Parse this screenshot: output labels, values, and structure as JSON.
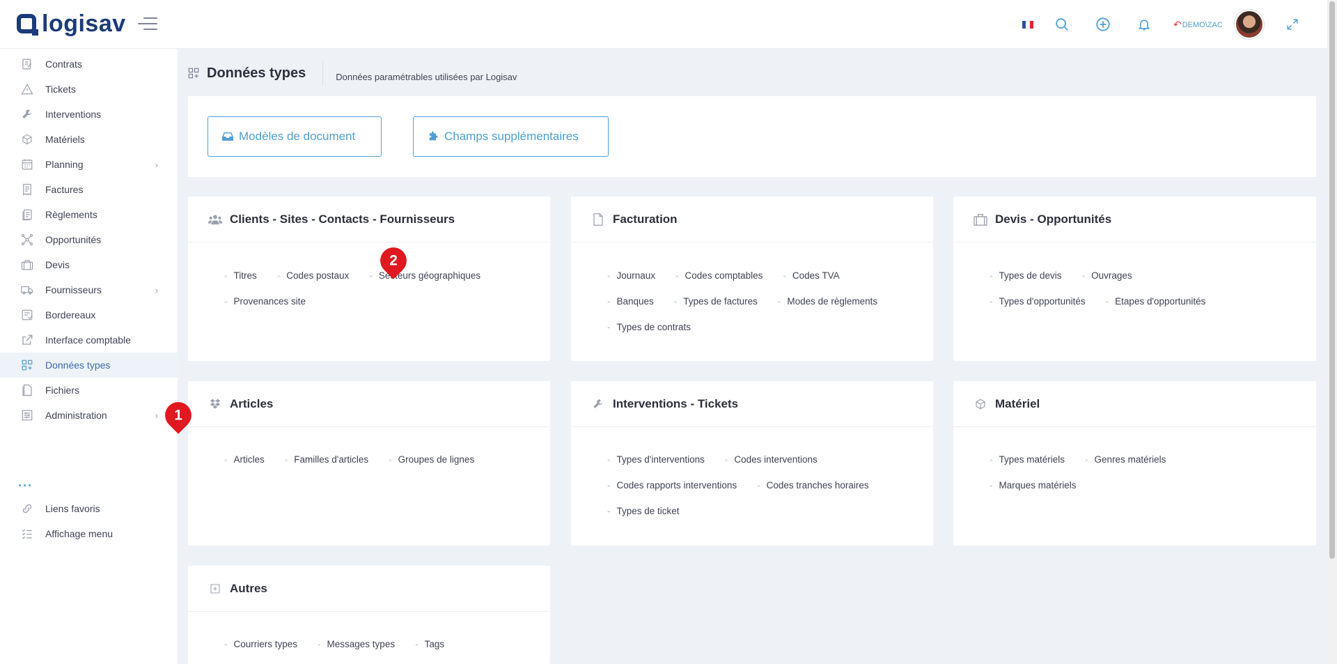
{
  "header": {
    "logo_text": "logisav",
    "flag_colors": [
      "#2b4fa6",
      "#ffffff",
      "#e4262c"
    ],
    "user_label": "DEMO\\ZAC",
    "icons": [
      "search-icon",
      "plus-circle-icon",
      "bell-icon",
      "expand-icon"
    ]
  },
  "sidebar": {
    "items": [
      {
        "label": "Contrats",
        "icon": "contract-icon"
      },
      {
        "label": "Tickets",
        "icon": "warning-icon"
      },
      {
        "label": "Interventions",
        "icon": "wrench-icon"
      },
      {
        "label": "Matériels",
        "icon": "box-icon"
      },
      {
        "label": "Planning",
        "icon": "calendar-icon"
      },
      {
        "label": "Factures",
        "icon": "invoice-icon"
      },
      {
        "label": "Règlements",
        "icon": "payment-icon"
      },
      {
        "label": "Opportunités",
        "icon": "network-icon"
      },
      {
        "label": "Devis",
        "icon": "briefcase-icon"
      },
      {
        "label": "Fournisseurs",
        "icon": "truck-icon"
      },
      {
        "label": "Bordereaux",
        "icon": "slip-icon"
      },
      {
        "label": "Interface comptable",
        "icon": "external-link-icon"
      },
      {
        "label": "Données types",
        "icon": "grid-plus-icon"
      },
      {
        "label": "Fichiers",
        "icon": "file-icon"
      },
      {
        "label": "Administration",
        "icon": "settings-list-icon"
      }
    ],
    "more": "...",
    "bottom_items": [
      {
        "label": "Liens favoris",
        "icon": "link-icon"
      },
      {
        "label": "Affichage menu",
        "icon": "checklist-icon"
      }
    ]
  },
  "page": {
    "title": "Données types",
    "description": "Données paramétrables utilisées par Logisav"
  },
  "buttons": {
    "models": "Modèles de document",
    "fields": "Champs supplémentaires"
  },
  "cards": [
    {
      "title": "Clients - Sites - Contacts - Fournisseurs",
      "icon": "users-icon",
      "rows": [
        [
          "Titres",
          "Codes postaux",
          "Secteurs géographiques"
        ],
        [
          "Provenances site"
        ]
      ]
    },
    {
      "title": "Facturation",
      "icon": "document-icon",
      "rows": [
        [
          "Journaux",
          "Codes comptables",
          "Codes TVA"
        ],
        [
          "Banques",
          "Types de factures",
          "Modes de règlements"
        ],
        [
          "Types de contrats"
        ]
      ]
    },
    {
      "title": "Devis - Opportunités",
      "icon": "briefcase-icon",
      "rows": [
        [
          "Types de devis",
          "Ouvrages"
        ],
        [
          "Types d'opportunités",
          "Etapes d'opportunités"
        ]
      ]
    },
    {
      "title": "Articles",
      "icon": "dropbox-icon",
      "rows": [
        [
          "Articles",
          "Familles d'articles",
          "Groupes de lignes"
        ]
      ]
    },
    {
      "title": "Interventions - Tickets",
      "icon": "wrench-icon",
      "rows": [
        [
          "Types d'interventions",
          "Codes interventions"
        ],
        [
          "Codes rapports interventions",
          "Codes tranches horaires"
        ],
        [
          "Types de ticket"
        ]
      ]
    },
    {
      "title": "Matériel",
      "icon": "cube-icon",
      "rows": [
        [
          "Types matériels",
          "Genres matériels"
        ],
        [
          "Marques matériels"
        ]
      ]
    },
    {
      "title": "Autres",
      "icon": "plus-square-icon",
      "rows": [
        [
          "Courriers types",
          "Messages types",
          "Tags"
        ]
      ]
    }
  ],
  "markers": [
    "1",
    "2"
  ],
  "colors": {
    "accent": "#4e9fd8",
    "brand": "#1b3b7a",
    "marker": "#e0181f"
  }
}
